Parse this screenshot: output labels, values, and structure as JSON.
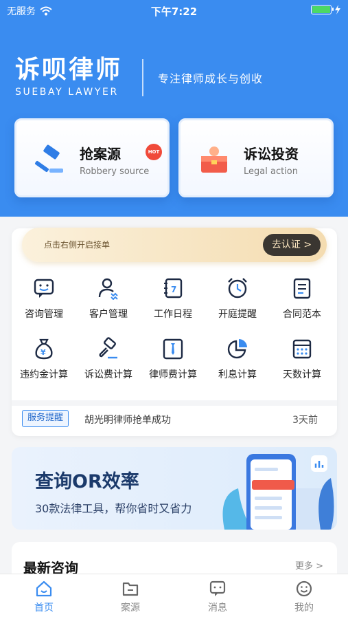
{
  "status_bar": {
    "carrier": "无服务",
    "time": "下午7:22",
    "battery_level": 1.0
  },
  "brand": {
    "name_cn": "诉呗律师",
    "name_en": "SUEBAY LAWYER",
    "slogan": "专注律师成长与创收"
  },
  "feature_cards": [
    {
      "title": "抢案源",
      "subtitle": "Robbery source",
      "badge": "HOT",
      "icon": "gavel-icon"
    },
    {
      "title": "诉讼投资",
      "subtitle": "Legal action",
      "icon": "briefcase-icon"
    }
  ],
  "banner": {
    "text": "点击右侧开启接单",
    "button": "去认证 >"
  },
  "tools": [
    {
      "label": "咨询管理",
      "icon": "chat-smile-icon"
    },
    {
      "label": "客户管理",
      "icon": "user-icon"
    },
    {
      "label": "工作日程",
      "icon": "calendar-7-icon"
    },
    {
      "label": "开庭提醒",
      "icon": "alarm-clock-icon"
    },
    {
      "label": "合同范本",
      "icon": "document-icon"
    },
    {
      "label": "违约金计算",
      "icon": "money-bag-icon"
    },
    {
      "label": "诉讼费计算",
      "icon": "gavel-calc-icon"
    },
    {
      "label": "律师费计算",
      "icon": "tie-icon"
    },
    {
      "label": "利息计算",
      "icon": "pie-chart-icon"
    },
    {
      "label": "天数计算",
      "icon": "calendar-grid-icon"
    }
  ],
  "notice": {
    "tag": "服务提醒",
    "message": "胡光明律师抢单成功",
    "time": "3天前"
  },
  "promo": {
    "title": "查询OR效率",
    "subtitle": "30款法律工具，帮你省时又省力"
  },
  "latest": {
    "title": "最新咨询",
    "more": "更多 >"
  },
  "tabbar": [
    {
      "label": "首页",
      "icon": "home-icon",
      "active": true
    },
    {
      "label": "案源",
      "icon": "folder-icon",
      "active": false
    },
    {
      "label": "消息",
      "icon": "message-icon",
      "active": false
    },
    {
      "label": "我的",
      "icon": "smile-icon",
      "active": false
    }
  ],
  "colors": {
    "primary": "#3a8cf0",
    "hot": "#f04a3a",
    "banner_button": "#3a3631"
  }
}
